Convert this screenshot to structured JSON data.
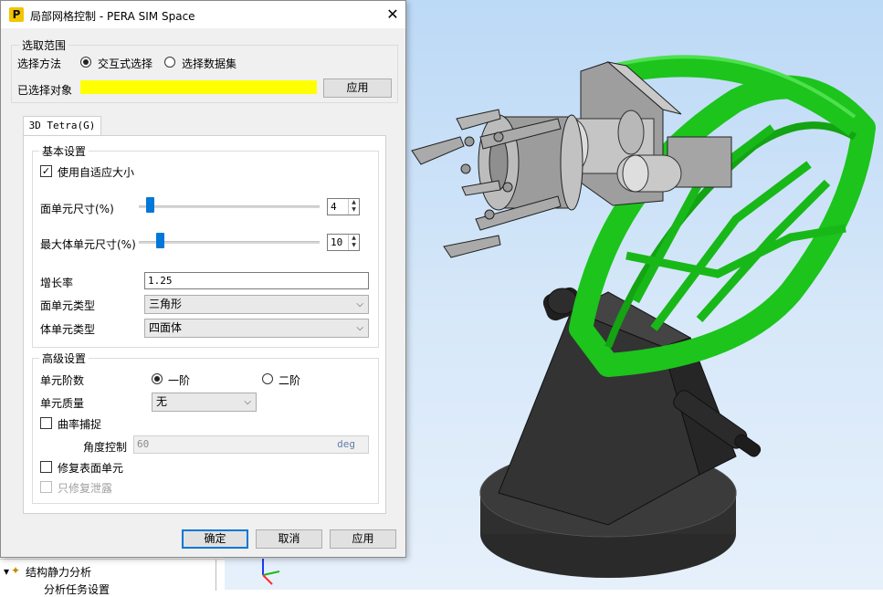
{
  "window": {
    "title": "局部网格控制 - PERA SIM Space",
    "app_icon": "pera-logo-icon",
    "close_glyph": "✕"
  },
  "selection": {
    "group_title": "选取范围",
    "method_label": "选择方法",
    "options": [
      {
        "label": "交互式选择",
        "selected": true
      },
      {
        "label": "选择数据集",
        "selected": false
      }
    ],
    "selected_label": "已选择对象",
    "selected_color": "#ffff00",
    "apply_label": "应用"
  },
  "tab": {
    "label": "3D Tetra(G)"
  },
  "basic": {
    "group_title": "基本设置",
    "adaptive_label": "使用自适应大小",
    "adaptive_checked": true,
    "face_size_label": "面单元尺寸(%)",
    "face_size_value": "4",
    "face_size_fraction": 0.04,
    "max_size_label": "最大体单元尺寸(%)",
    "max_size_value": "10",
    "max_size_fraction": 0.1,
    "growth_label": "增长率",
    "growth_value": "1.25",
    "face_type_label": "面单元类型",
    "face_type_value": "三角形",
    "body_type_label": "体单元类型",
    "body_type_value": "四面体"
  },
  "advanced": {
    "group_title": "高级设置",
    "order_label": "单元阶数",
    "order_options": [
      {
        "label": "一阶",
        "selected": true
      },
      {
        "label": "二阶",
        "selected": false
      }
    ],
    "quality_label": "单元质量",
    "quality_value": "无",
    "curvature_label": "曲率捕捉",
    "curvature_checked": false,
    "angle_label": "角度控制",
    "angle_value": "60",
    "angle_unit": "deg",
    "repair_label": "修复表面单元",
    "repair_checked": false,
    "repair_leak_label": "只修复泄露",
    "repair_leak_checked": false
  },
  "footer": {
    "ok_label": "确定",
    "cancel_label": "取消",
    "apply_label": "应用"
  },
  "tree": {
    "item1": "结构静力分析",
    "item2": "分析任务设置"
  },
  "colors": {
    "accent": "#0078d7",
    "highlight_green": "#22cc22",
    "viewport_top": "#bcd9f6"
  }
}
